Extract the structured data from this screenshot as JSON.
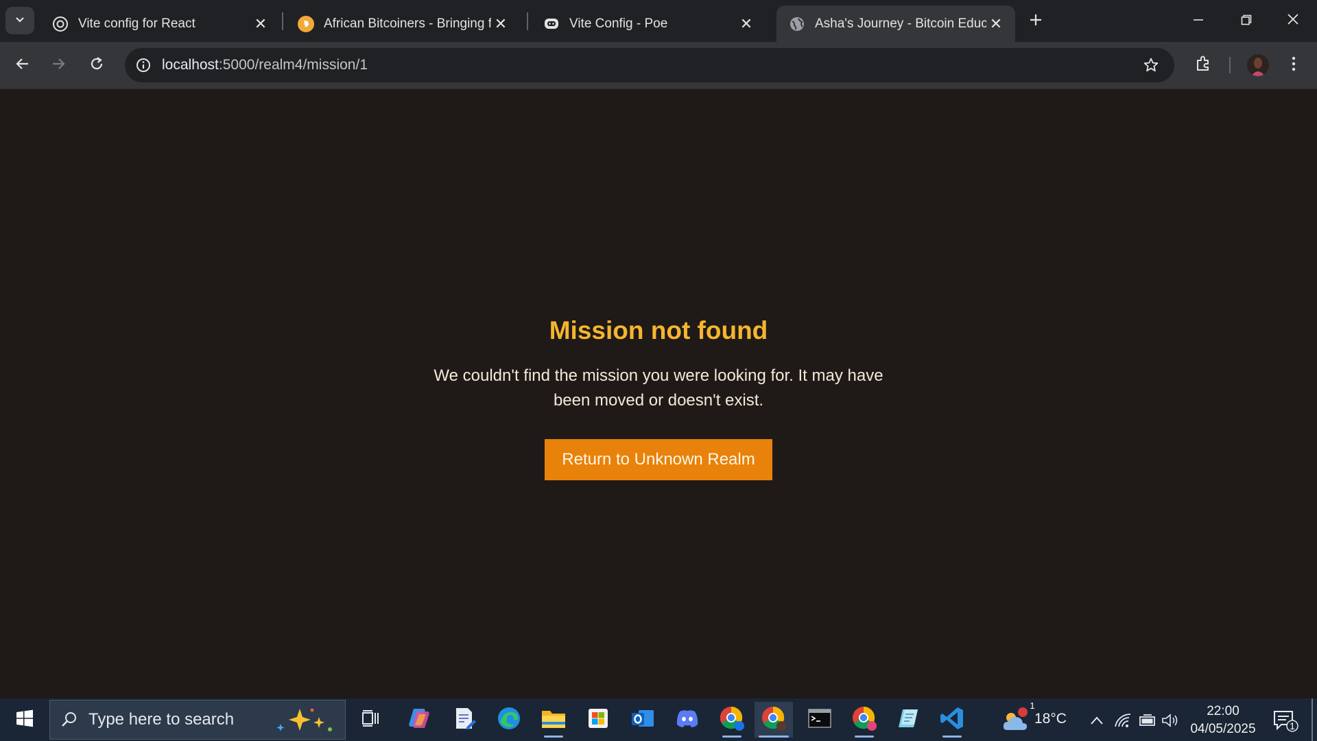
{
  "browser": {
    "tabs": [
      {
        "title": "Vite config for React",
        "icon": "openai-icon"
      },
      {
        "title": "African Bitcoiners - Bringing free",
        "icon": "african-bitcoiners-icon"
      },
      {
        "title": "Vite Config - Poe",
        "icon": "poe-icon"
      },
      {
        "title": "Asha's Journey - Bitcoin Education",
        "icon": "globe-icon",
        "active": true
      }
    ],
    "url_host": "localhost",
    "url_path": ":5000/realm4/mission/1"
  },
  "page": {
    "heading": "Mission not found",
    "description": "We couldn't find the mission you were looking for. It may have been moved or doesn't exist.",
    "button_label": "Return to Unknown Realm"
  },
  "taskbar": {
    "search_placeholder": "Type here to search",
    "weather": "18°C",
    "weather_badge": "1",
    "time": "22:00",
    "date": "04/05/2025",
    "notification_count": "1"
  },
  "colors": {
    "heading": "#f5b52e",
    "button": "#e8820a",
    "page_background": "#1f1a17"
  }
}
